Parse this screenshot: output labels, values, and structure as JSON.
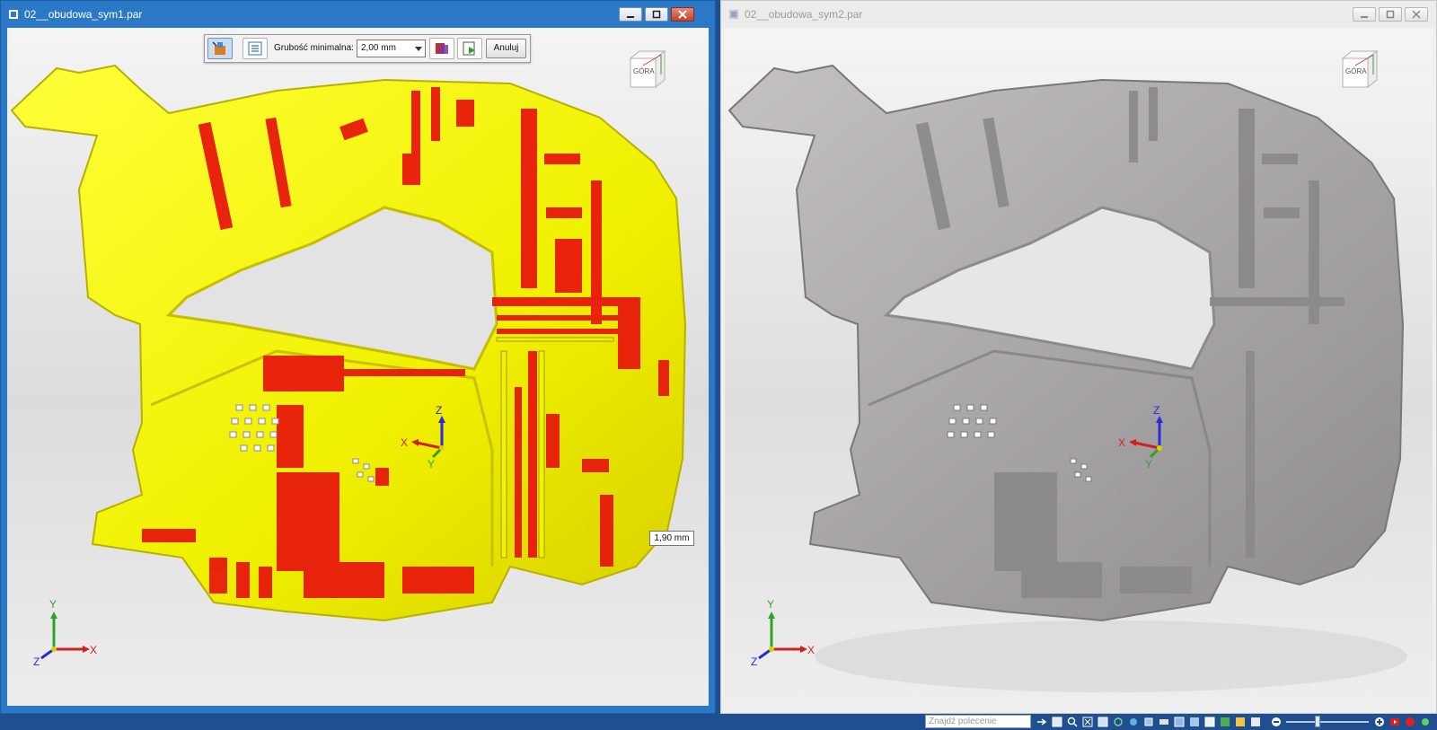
{
  "left_window": {
    "title": "02__obudowa_sym1.par",
    "toolbar": {
      "label": "Grubość minimalna:",
      "value": "2,00 mm",
      "cancel_label": "Anuluj"
    },
    "viewcube_label": "GÓRA",
    "tooltip": "1,90 mm",
    "model_colors": {
      "surface": "#f2f200",
      "thin_area": "#e8190c"
    }
  },
  "right_window": {
    "title": "02__obudowa_sym2.par",
    "viewcube_label": "GÓRA",
    "model_colors": {
      "surface": "#a9a6a7"
    }
  },
  "axes": {
    "x": "X",
    "y": "Y",
    "z": "Z"
  },
  "taskbar": {
    "search_placeholder": "Znajdź polecenie"
  }
}
